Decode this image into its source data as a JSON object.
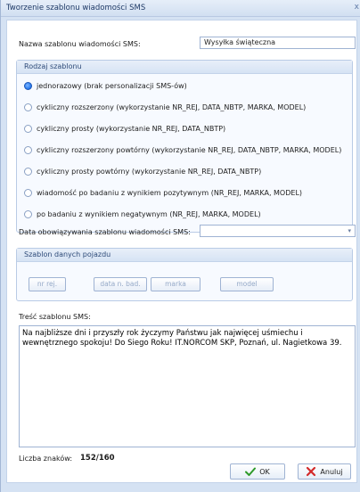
{
  "window": {
    "title": "Tworzenie szablonu wiadomości SMS",
    "close_glyph": "x"
  },
  "template_name": {
    "label": "Nazwa szablonu wiadomości SMS:",
    "value": "Wysyłka świąteczna"
  },
  "type_group": {
    "title": "Rodzaj szablonu",
    "options": [
      {
        "label": "jednorazowy (brak personalizacji SMS-ów)",
        "selected": true
      },
      {
        "label": "cykliczny rozszerzony (wykorzystanie NR_REJ, DATA_NBTP, MARKA, MODEL)",
        "selected": false
      },
      {
        "label": "cykliczny prosty (wykorzystanie NR_REJ, DATA_NBTP)",
        "selected": false
      },
      {
        "label": "cykliczny rozszerzony powtórny (wykorzystanie NR_REJ, DATA_NBTP, MARKA, MODEL)",
        "selected": false
      },
      {
        "label": "cykliczny prosty powtórny (wykorzystanie NR_REJ, DATA_NBTP)",
        "selected": false
      },
      {
        "label": "wiadomość po badaniu z wynikiem pozytywnym (NR_REJ, MARKA, MODEL)",
        "selected": false
      },
      {
        "label": "po badaniu z wynikiem negatywnym (NR_REJ, MARKA, MODEL)",
        "selected": false
      }
    ]
  },
  "date": {
    "label": "Data obowiązywania szablonu wiadomości SMS:",
    "value": ""
  },
  "vehicle_group": {
    "title": "Szablon danych pojazdu",
    "buttons": [
      "nr rej.",
      "data n. bad.",
      "marka",
      "model"
    ]
  },
  "content": {
    "label": "Treść szablonu SMS:",
    "text": "Na najbliższe dni i przyszły rok życzymy Państwu jak najwięcej uśmiechu i wewnętrznego spokoju! Do Siego Roku! IT.NORCOM SKP, Poznań, ul. Nagietkowa 39."
  },
  "counter": {
    "label": "Liczba znaków:",
    "value": "152/160"
  },
  "actions": {
    "ok": "OK",
    "cancel": "Anuluj"
  }
}
